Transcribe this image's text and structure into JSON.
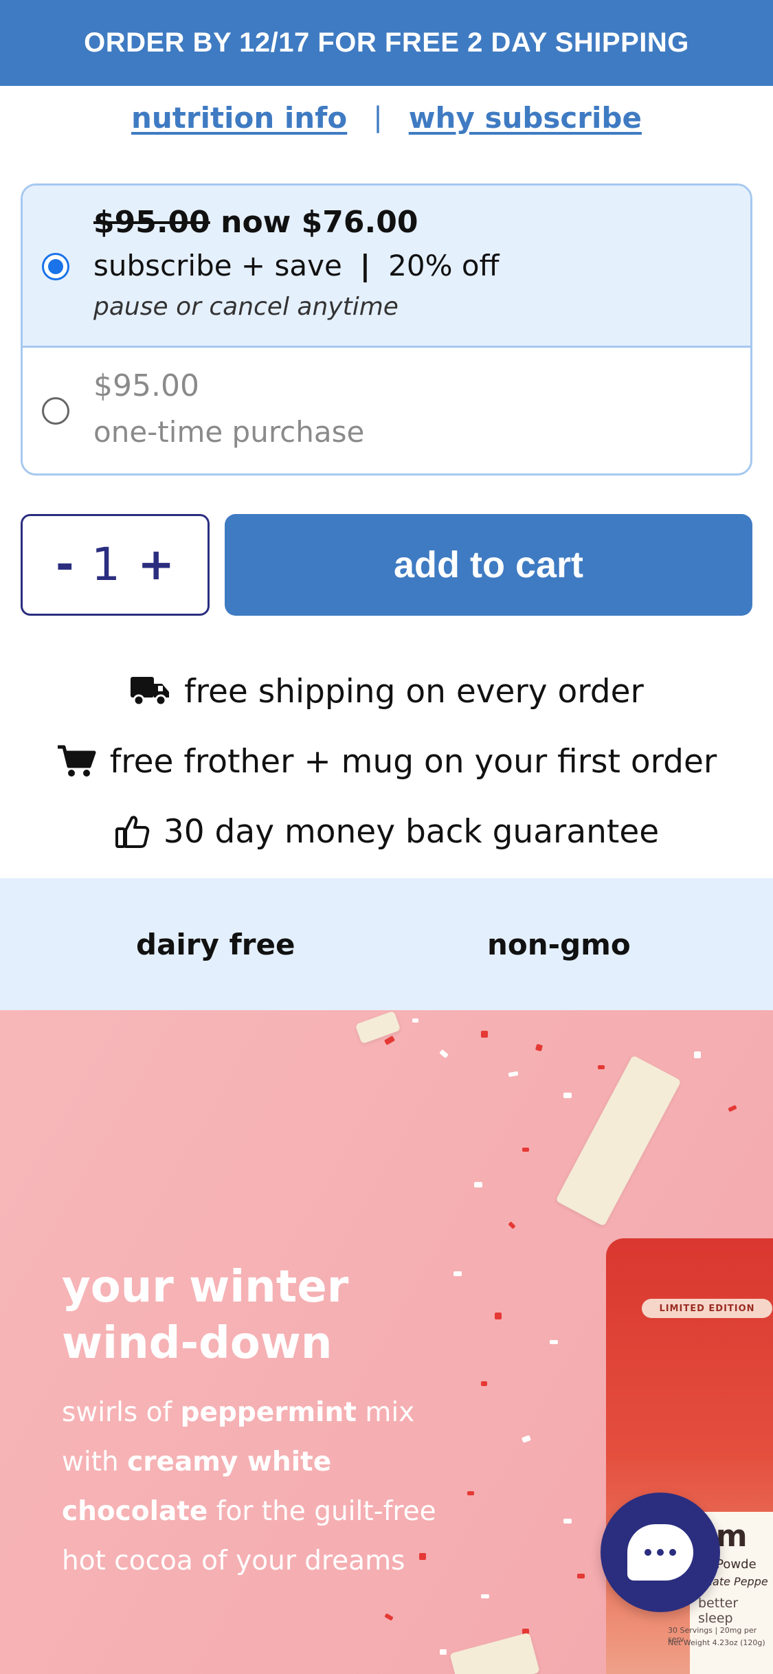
{
  "banner": {
    "text": "ORDER BY 12/17 FOR FREE 2 DAY SHIPPING"
  },
  "links": {
    "nutrition": "nutrition info",
    "separator": "|",
    "why_subscribe": "why subscribe"
  },
  "purchase_options": {
    "subscribe": {
      "old_price": "$95.00",
      "now_word": "now",
      "new_price": "$76.00",
      "label": "subscribe + save",
      "separator": "|",
      "discount": "20% off",
      "note": "pause or cancel anytime",
      "selected": true
    },
    "one_time": {
      "price": "$95.00",
      "label": "one-time purchase",
      "selected": false
    }
  },
  "quantity": {
    "minus": "-",
    "value": "1",
    "plus": "+"
  },
  "cart_button": {
    "label": "add to cart"
  },
  "perks": [
    {
      "icon": "truck-icon",
      "text": "free shipping on every order"
    },
    {
      "icon": "cart-icon",
      "text": "free frother + mug on your first order"
    },
    {
      "icon": "thumbs-up-icon",
      "text": "30 day money back guarantee"
    }
  ],
  "badges": [
    "dairy free",
    "non-gmo"
  ],
  "hero": {
    "title_line1": "your winter",
    "title_line2": "wind-down",
    "body_parts": {
      "p1": "swirls of ",
      "b1": "peppermint",
      "p2": " mix with ",
      "b2": "creamy white chocolate",
      "p3": " for the guilt-free hot cocoa of your dreams"
    },
    "pouch": {
      "label": "LIMITED EDITION",
      "brand_fragment": "am",
      "line1": "ne Powde",
      "line2": "colate Peppe",
      "line3": "better sleep",
      "line4": "30 Servings | 20mg per serv",
      "line5": "Net Weight 4.23oz (120g)"
    }
  },
  "colors": {
    "brand_blue": "#3f7bc2",
    "navy": "#2b2e7f",
    "selected_bg": "#e5f0fd",
    "hero_pink": "#f5b0b3"
  }
}
